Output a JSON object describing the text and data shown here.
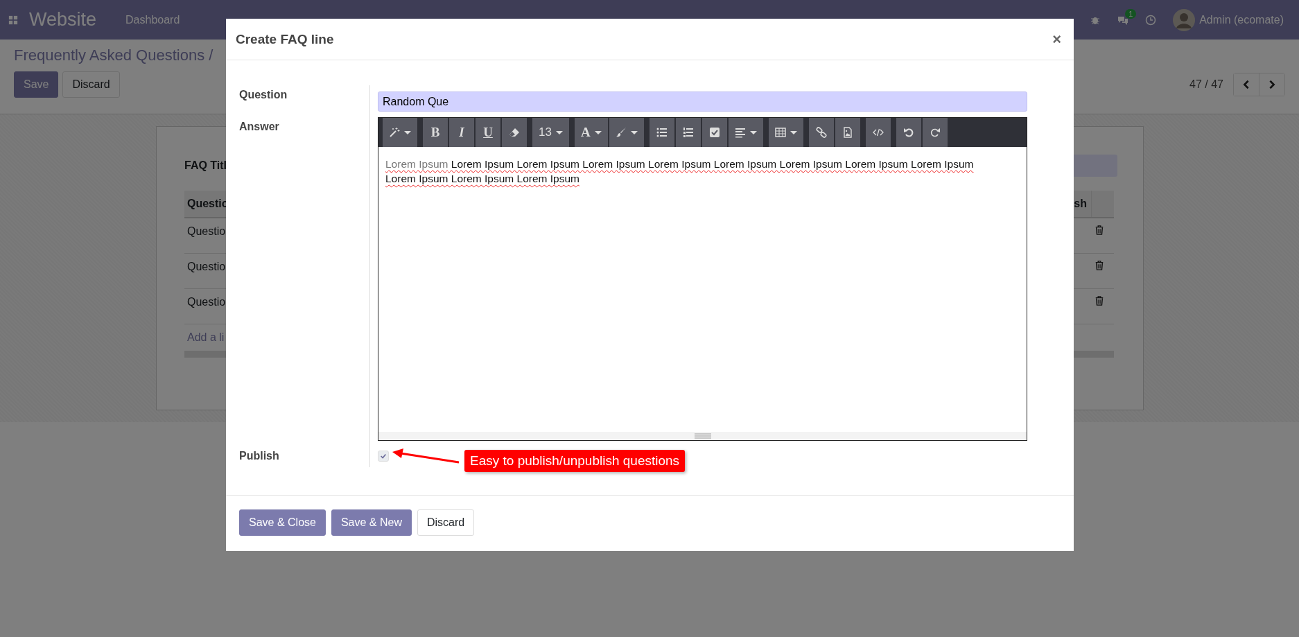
{
  "navbar": {
    "app_name": "Website",
    "menu": [
      "Dashboard"
    ],
    "chat_badge": "1",
    "user": "Admin (ecomate)"
  },
  "control_panel": {
    "breadcrumb": "Frequently Asked Questions /",
    "buttons": [
      {
        "label": "Save",
        "primary": true
      },
      {
        "label": "Discard",
        "primary": false
      }
    ],
    "pager": "47 / 47"
  },
  "sheet": {
    "title_label": "FAQ Titl",
    "table": {
      "columns": [
        "Questio",
        "sh"
      ],
      "rows": [
        "Questio",
        "Questio",
        "Questio"
      ],
      "add_line": "Add a li"
    }
  },
  "dialog": {
    "title": "Create FAQ line",
    "close": "×",
    "fields": [
      {
        "kind": "text",
        "label": "Question",
        "value": "Random Que"
      },
      {
        "kind": "html",
        "label": "Answer",
        "toolbar": [
          [
            {
              "kind": "wand",
              "dropdown": true
            }
          ],
          [
            {
              "kind": "bold",
              "label": "B",
              "dropdown": false
            },
            {
              "kind": "italic",
              "label": "I",
              "dropdown": false
            },
            {
              "kind": "underline",
              "label": "U",
              "dropdown": false
            },
            {
              "kind": "eraser",
              "dropdown": false
            }
          ],
          [
            {
              "kind": "size",
              "label": "13",
              "dropdown": true
            }
          ],
          [
            {
              "kind": "color",
              "label": "A",
              "dropdown": true
            },
            {
              "kind": "brush",
              "dropdown": true
            }
          ],
          [
            {
              "kind": "bullets",
              "dropdown": false
            },
            {
              "kind": "numbers",
              "dropdown": false
            },
            {
              "kind": "checkbox",
              "dropdown": false
            },
            {
              "kind": "align",
              "dropdown": true
            }
          ],
          [
            {
              "kind": "table",
              "dropdown": true
            }
          ],
          [
            {
              "kind": "link",
              "dropdown": false
            },
            {
              "kind": "image",
              "dropdown": false
            }
          ],
          [
            {
              "kind": "code",
              "dropdown": false
            }
          ],
          [
            {
              "kind": "undo",
              "dropdown": false
            },
            {
              "kind": "redo",
              "dropdown": false
            }
          ]
        ],
        "segments": [
          {
            "text": "Lorem Ipsum",
            "muted": true
          },
          {
            "text": " Lorem Ipsum Lorem Ipsum Lorem Ipsum Lorem Ipsum Lorem Ipsum Lorem Ipsum Lorem Ipsum Lorem Ipsum Lorem Ipsum Lorem Ipsum Lorem Ipsum",
            "muted": false
          }
        ]
      },
      {
        "kind": "checkbox",
        "label": "Publish",
        "checked": true
      }
    ],
    "annotation": "Easy to publish/unpublish questions",
    "buttons": [
      {
        "label": "Save & Close",
        "primary": true
      },
      {
        "label": "Save & New",
        "primary": true
      },
      {
        "label": "Discard",
        "primary": false
      }
    ]
  }
}
